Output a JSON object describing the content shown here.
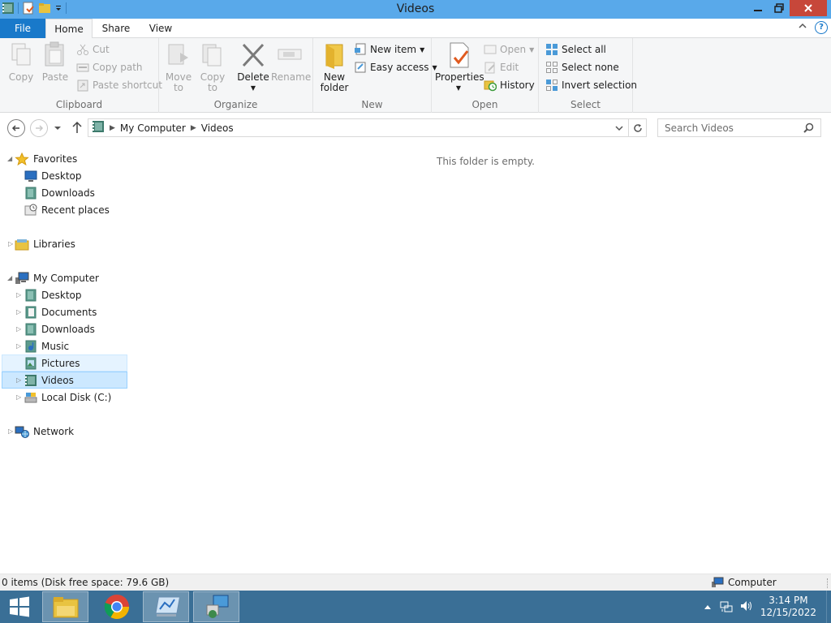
{
  "window": {
    "title": "Videos",
    "minimize": "—",
    "maximize": "❐",
    "close": "✕"
  },
  "tabs": {
    "file": "File",
    "home": "Home",
    "share": "Share",
    "view": "View",
    "help": "?"
  },
  "ribbon": {
    "clipboard": {
      "label": "Clipboard",
      "copy": "Copy",
      "paste": "Paste",
      "cut": "Cut",
      "copy_path": "Copy path",
      "paste_shortcut": "Paste shortcut"
    },
    "organize": {
      "label": "Organize",
      "move_to_1": "Move",
      "move_to_2": "to",
      "copy_to_1": "Copy",
      "copy_to_2": "to",
      "delete": "Delete",
      "rename": "Rename"
    },
    "new": {
      "label": "New",
      "new_folder_1": "New",
      "new_folder_2": "folder",
      "new_item": "New item",
      "easy_access": "Easy access"
    },
    "open": {
      "label": "Open",
      "properties": "Properties",
      "open": "Open",
      "edit": "Edit",
      "history": "History"
    },
    "select": {
      "label": "Select",
      "select_all": "Select all",
      "select_none": "Select none",
      "invert_selection": "Invert selection"
    }
  },
  "address": {
    "crumbs": [
      "My Computer",
      "Videos"
    ],
    "search_placeholder": "Search Videos"
  },
  "tree": {
    "favorites": "Favorites",
    "fav_items": [
      "Desktop",
      "Downloads",
      "Recent places"
    ],
    "libraries": "Libraries",
    "computer": "My Computer",
    "computer_items": [
      "Desktop",
      "Documents",
      "Downloads",
      "Music",
      "Pictures",
      "Videos",
      "Local Disk (C:)"
    ],
    "network": "Network"
  },
  "content": {
    "empty_message": "This folder is empty."
  },
  "status": {
    "left": "0 items (Disk free space: 79.6 GB)",
    "right": "Computer"
  },
  "taskbar": {
    "time": "3:14 PM",
    "date": "12/15/2022"
  },
  "colors": {
    "titlebar": "#59a9ea",
    "file_tab": "#1979ca",
    "close": "#c7473a",
    "taskbar": "#3a6f96",
    "selection": "#cce8ff"
  }
}
